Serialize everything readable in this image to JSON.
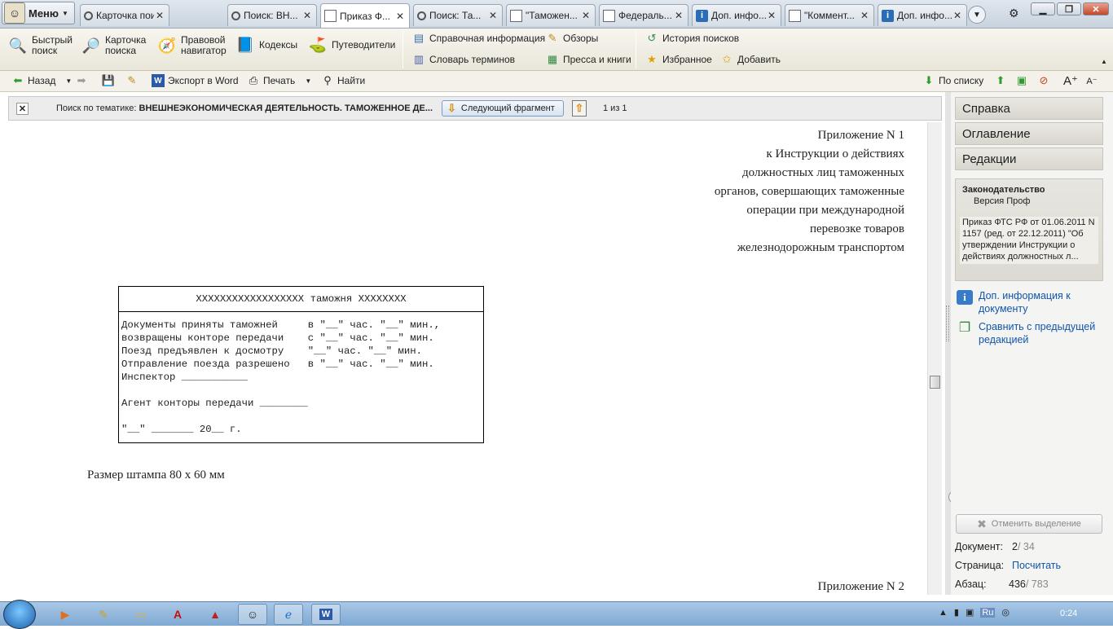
{
  "menu": {
    "label": "Меню"
  },
  "tabs": [
    {
      "label": "Карточка поиска",
      "icon": "search-icon"
    },
    {
      "label": "Поиск: ВН...",
      "icon": "search-icon"
    },
    {
      "label": "Приказ Ф...",
      "icon": "document-icon",
      "active": true
    },
    {
      "label": "Поиск: Та...",
      "icon": "search-icon"
    },
    {
      "label": "\"Таможен...",
      "icon": "document-icon"
    },
    {
      "label": "Федераль...",
      "icon": "document-icon"
    },
    {
      "label": "Доп. инфо...",
      "icon": "info-icon"
    },
    {
      "label": "\"Коммент...",
      "icon": "document-icon"
    },
    {
      "label": "Доп. инфо...",
      "icon": "info-icon"
    }
  ],
  "toolbar": {
    "quick_search": "Быстрый\nпоиск",
    "search_card": "Карточка\nпоиска",
    "legal_navigator": "Правовой\nнавигатор",
    "codes": "Кодексы",
    "guides": "Путеводители",
    "reference_info": "Справочная информация",
    "glossary": "Словарь терминов",
    "reviews": "Обзоры",
    "press_books": "Пресса и книги",
    "search_history": "История поисков",
    "favorites": "Избранное",
    "add": "Добавить"
  },
  "navbar": {
    "back": "Назад",
    "export_word": "Экспорт в Word",
    "print": "Печать",
    "find": "Найти",
    "by_list": "По списку"
  },
  "searchbar": {
    "prefix": "Поиск по тематике: ",
    "topic": "ВНЕШНЕЭКОНОМИЧЕСКАЯ ДЕЯТЕЛЬНОСТЬ. ТАМОЖЕННОЕ ДЕ...",
    "next_fragment": "Следующий фрагмент",
    "count": "1 из 1"
  },
  "document": {
    "appendix_lines": [
      "Приложение N 1",
      "к Инструкции о действиях",
      "должностных лиц таможенных",
      "органов, совершающих таможенные",
      "операции при международной",
      "перевозке товаров",
      "железнодорожным транспортом"
    ],
    "stamp_header": "XXXXXXXXXXXXXXXXXX таможня XXXXXXXX",
    "stamp_lines": [
      "Документы приняты таможней     в \"__\" час. \"__\" мин.,",
      "возвращены конторе передачи    с \"__\" час. \"__\" мин.",
      "Поезд предъявлен к досмотру    \"__\" час. \"__\" мин.",
      "Отправление поезда разрешено   в \"__\" час. \"__\" мин.",
      "Инспектор ___________",
      "",
      "Агент конторы передачи ________",
      "",
      "\"__\" _______ 20__ г."
    ],
    "stamp_size": "Размер штампа 80 x 60 мм",
    "next_appendix": "Приложение N 2"
  },
  "right_panel": {
    "tabs": [
      "Справка",
      "Оглавление",
      "Редакции"
    ],
    "card_title": "Законодательство",
    "card_subtitle": "Версия Проф",
    "card_doc": "Приказ ФТС РФ от 01.06.2011 N 1157 (ред. от 22.12.2011) \"Об утверждении Инструкции о действиях должностных л...",
    "link_additional": "Доп. информация к документу",
    "link_compare": "Сравнить с предыдущей редакцией",
    "unselect": "Отменить выделение",
    "doc_label": "Документ:",
    "doc_current": "2",
    "doc_total": " / 34",
    "page_label": "Страница:",
    "page_value": "Посчитать",
    "para_label": "Абзац:",
    "para_current": "436",
    "para_total": " / 783"
  },
  "taskbar": {
    "lang": "Ru",
    "clock": "0:24"
  },
  "colors": {
    "link": "#1155aa",
    "accent": "#e28a00"
  }
}
